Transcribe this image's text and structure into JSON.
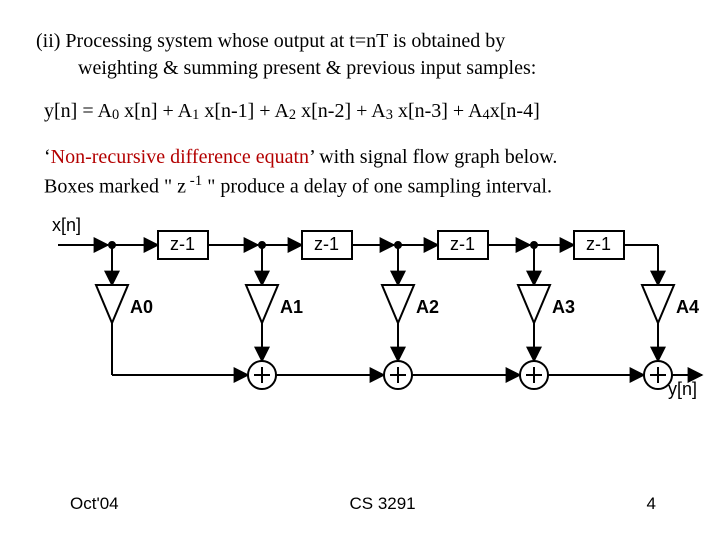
{
  "para1_a": "(ii)  Processing  system  whose  output  at  t=nT  is  obtained  by",
  "para1_b": "weighting & summing  present & previous input samples:",
  "eq_parts": {
    "lhs": "y[n]  =  A",
    "c0": "0",
    "t1": " x[n]  + A",
    "c1": "1",
    "t2": " x[n-1]  +  A",
    "c2": "2",
    "t3": " x[n-2]  + A",
    "c3": "3",
    "t4": " x[n-3]  + A",
    "c4": "4",
    "t5": "x[n-4]"
  },
  "para2_red": "Non-recursive difference equatn",
  "para2_tail": "’ with signal flow graph below.",
  "para2_line2a": "Boxes marked \" z",
  "para2_sup": " -1",
  "para2_line2b": " \" produce a delay of one sampling interval.",
  "quote_open": "‘",
  "diagram": {
    "input_label": "x[n]",
    "output_label": "y[n]",
    "delay_boxes": [
      "z-1",
      "z-1",
      "z-1",
      "z-1"
    ],
    "gain_labels": [
      "A0",
      "A1",
      "A2",
      "A3",
      "A4"
    ]
  },
  "footer": {
    "left": "Oct'04",
    "center": "CS 3291",
    "right": "4"
  },
  "chart_data": {
    "type": "table",
    "title": "Non-recursive FIR signal flow graph (5-tap)",
    "equation": "y[n] = A0*x[n] + A1*x[n-1] + A2*x[n-2] + A3*x[n-3] + A4*x[n-4]",
    "taps": [
      {
        "delay": 0,
        "gain": "A0"
      },
      {
        "delay": 1,
        "gain": "A1"
      },
      {
        "delay": 2,
        "gain": "A2"
      },
      {
        "delay": 3,
        "gain": "A3"
      },
      {
        "delay": 4,
        "gain": "A4"
      }
    ],
    "delay_element_label": "z^-1"
  }
}
